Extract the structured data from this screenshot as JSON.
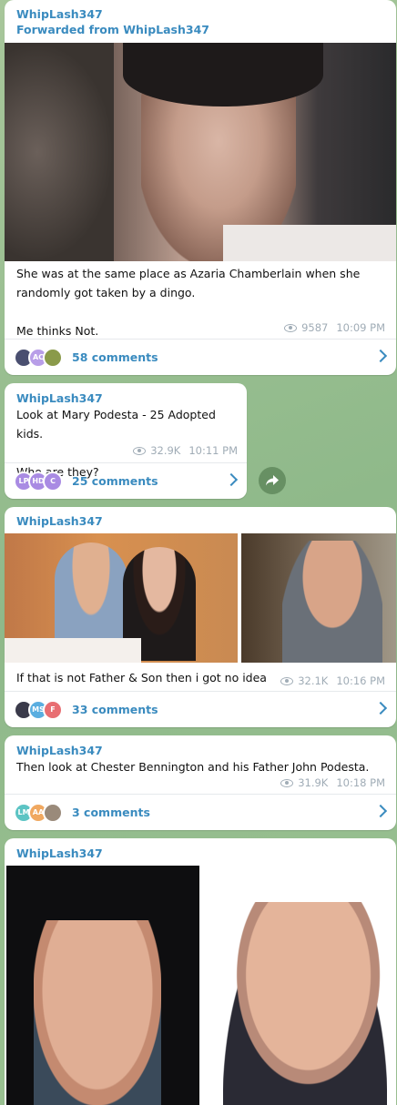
{
  "messages": [
    {
      "author": "WhipLash347",
      "forwarded": "Forwarded from WhipLash347",
      "text": "She was at the same place as Azaria Chamberlain when she randomly got taken by a dingo.\n\nMe thinks Not.",
      "views": "9587",
      "time": "10:09 PM",
      "comments": "58 comments",
      "avatars": [
        {
          "label": "",
          "color": "#4a4f70"
        },
        {
          "label": "AC",
          "color": "#b89ee8"
        },
        {
          "label": "",
          "color": "#8a9a4a"
        }
      ]
    },
    {
      "author": "WhipLash347",
      "text": "Look at Mary Podesta - 25 Adopted kids.\n\nWho are they?",
      "views": "32.9K",
      "time": "10:11 PM",
      "comments": "25 comments",
      "avatars": [
        {
          "label": "LP",
          "color": "#a98be3"
        },
        {
          "label": "HD",
          "color": "#a98be3"
        },
        {
          "label": "C",
          "color": "#a98be3"
        }
      ]
    },
    {
      "author": "WhipLash347",
      "text": "If that is not Father & Son then i got no idea",
      "views": "32.1K",
      "time": "10:16 PM",
      "comments": "33 comments",
      "avatars": [
        {
          "label": "",
          "color": "#3a3a4a"
        },
        {
          "label": "MS",
          "color": "#5aaee0"
        },
        {
          "label": "F",
          "color": "#e86e72"
        }
      ]
    },
    {
      "author": "WhipLash347",
      "text": "Then look at Chester Bennington and his Father John Podesta.",
      "views": "31.9K",
      "time": "10:18 PM",
      "comments": "3 comments",
      "avatars": [
        {
          "label": "LM",
          "color": "#5cc4c4"
        },
        {
          "label": "AA",
          "color": "#f0a860"
        },
        {
          "label": "",
          "color": "#9a8a7a"
        }
      ]
    },
    {
      "author": "WhipLash347"
    }
  ],
  "icons": {
    "views": "eye-icon",
    "chevron": "chevron-right-icon",
    "share": "share-icon"
  }
}
